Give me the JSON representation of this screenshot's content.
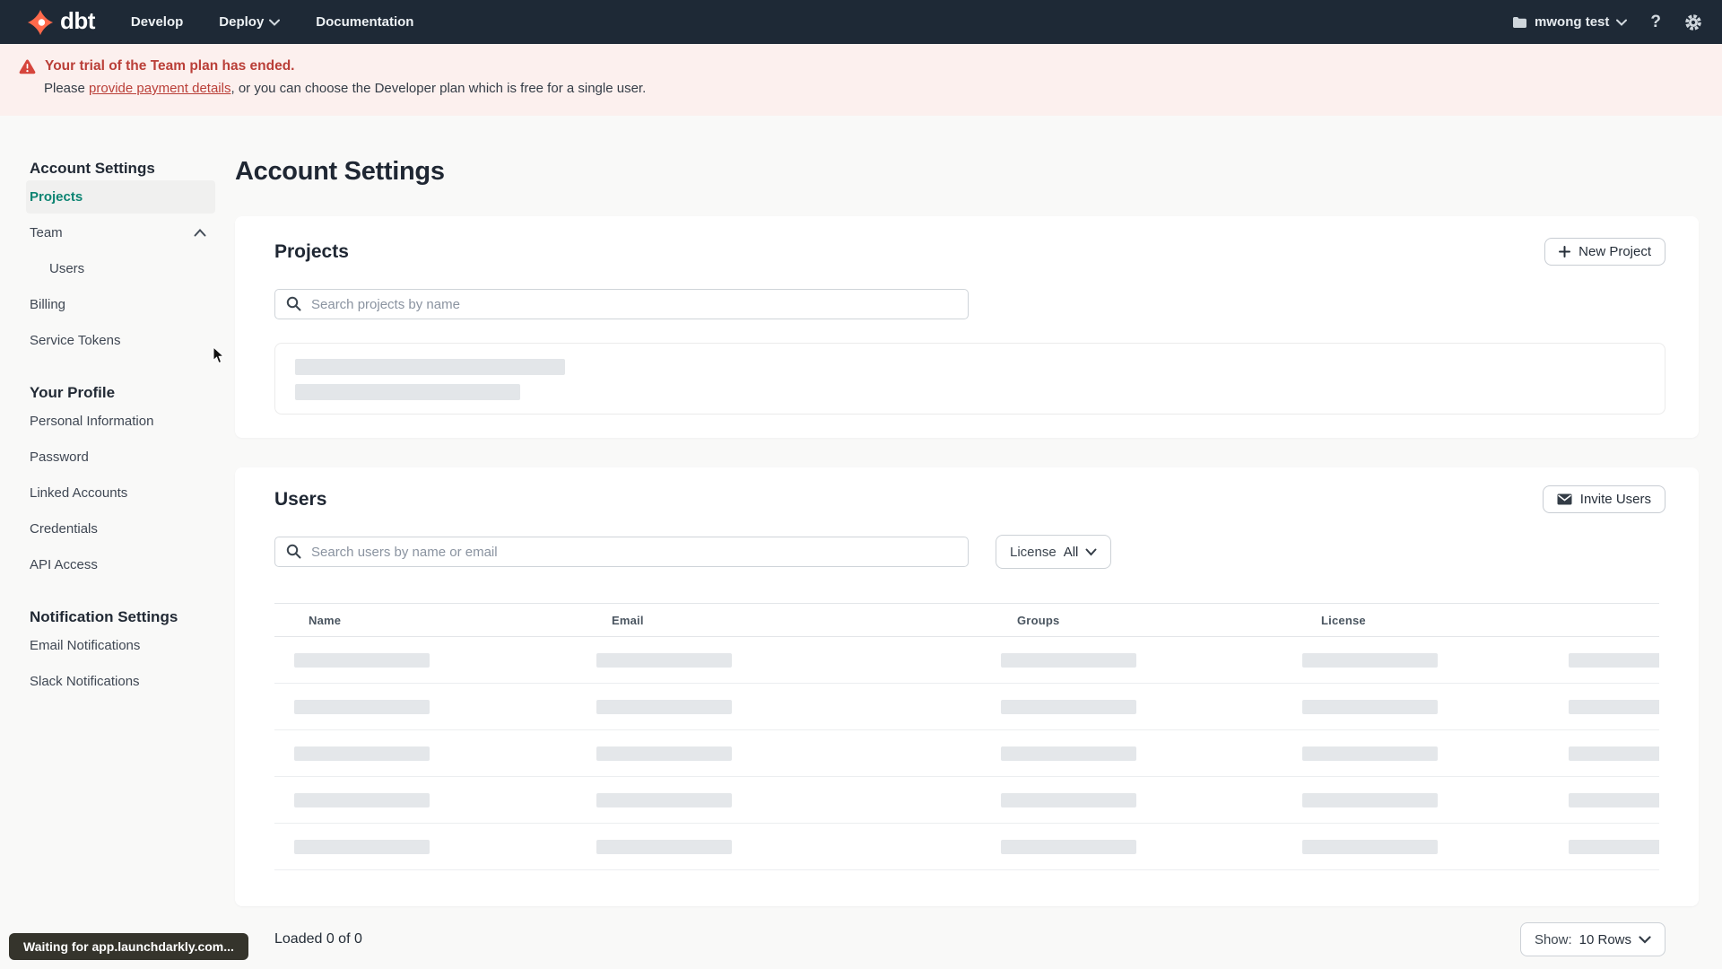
{
  "navbar": {
    "brand": "dbt",
    "links": [
      "Develop",
      "Deploy",
      "Documentation"
    ],
    "account_name": "mwong test",
    "help_label": "?"
  },
  "banner": {
    "title": "Your trial of the Team plan has ended.",
    "body_prefix": "Please ",
    "link_text": "provide payment details",
    "body_suffix": ", or you can choose the Developer plan which is free for a single user."
  },
  "page_title": "Account Settings",
  "sidebar": {
    "title": "Account Settings",
    "items": {
      "projects": "Projects",
      "team": "Team",
      "users": "Users",
      "billing": "Billing",
      "service_tokens": "Service Tokens"
    },
    "profile_title": "Your Profile",
    "profile_items": [
      "Personal Information",
      "Password",
      "Linked Accounts",
      "Credentials",
      "API Access"
    ],
    "notification_title": "Notification Settings",
    "notification_items": [
      "Email Notifications",
      "Slack Notifications"
    ]
  },
  "projects": {
    "title": "Projects",
    "new_button": "New Project",
    "search_placeholder": "Search projects by name"
  },
  "users": {
    "title": "Users",
    "invite_button": "Invite Users",
    "search_placeholder": "Search users by name or email",
    "filter_label": "License",
    "filter_value": "All",
    "table_headers": [
      "Name",
      "Email",
      "Groups",
      "License"
    ],
    "loaded_text": "Loaded 0 of 0",
    "show_label": "Show:",
    "show_value": "10 Rows"
  },
  "status_bar": "Waiting for app.launchdarkly.com...",
  "colors": {
    "navbar_bg": "#1e2936",
    "brand_orange": "#ff694b",
    "banner_bg": "#fcf0ee",
    "danger_red": "#ba3f38",
    "accent_teal": "#0c8472",
    "skeleton_gray": "#e4e7ea"
  }
}
